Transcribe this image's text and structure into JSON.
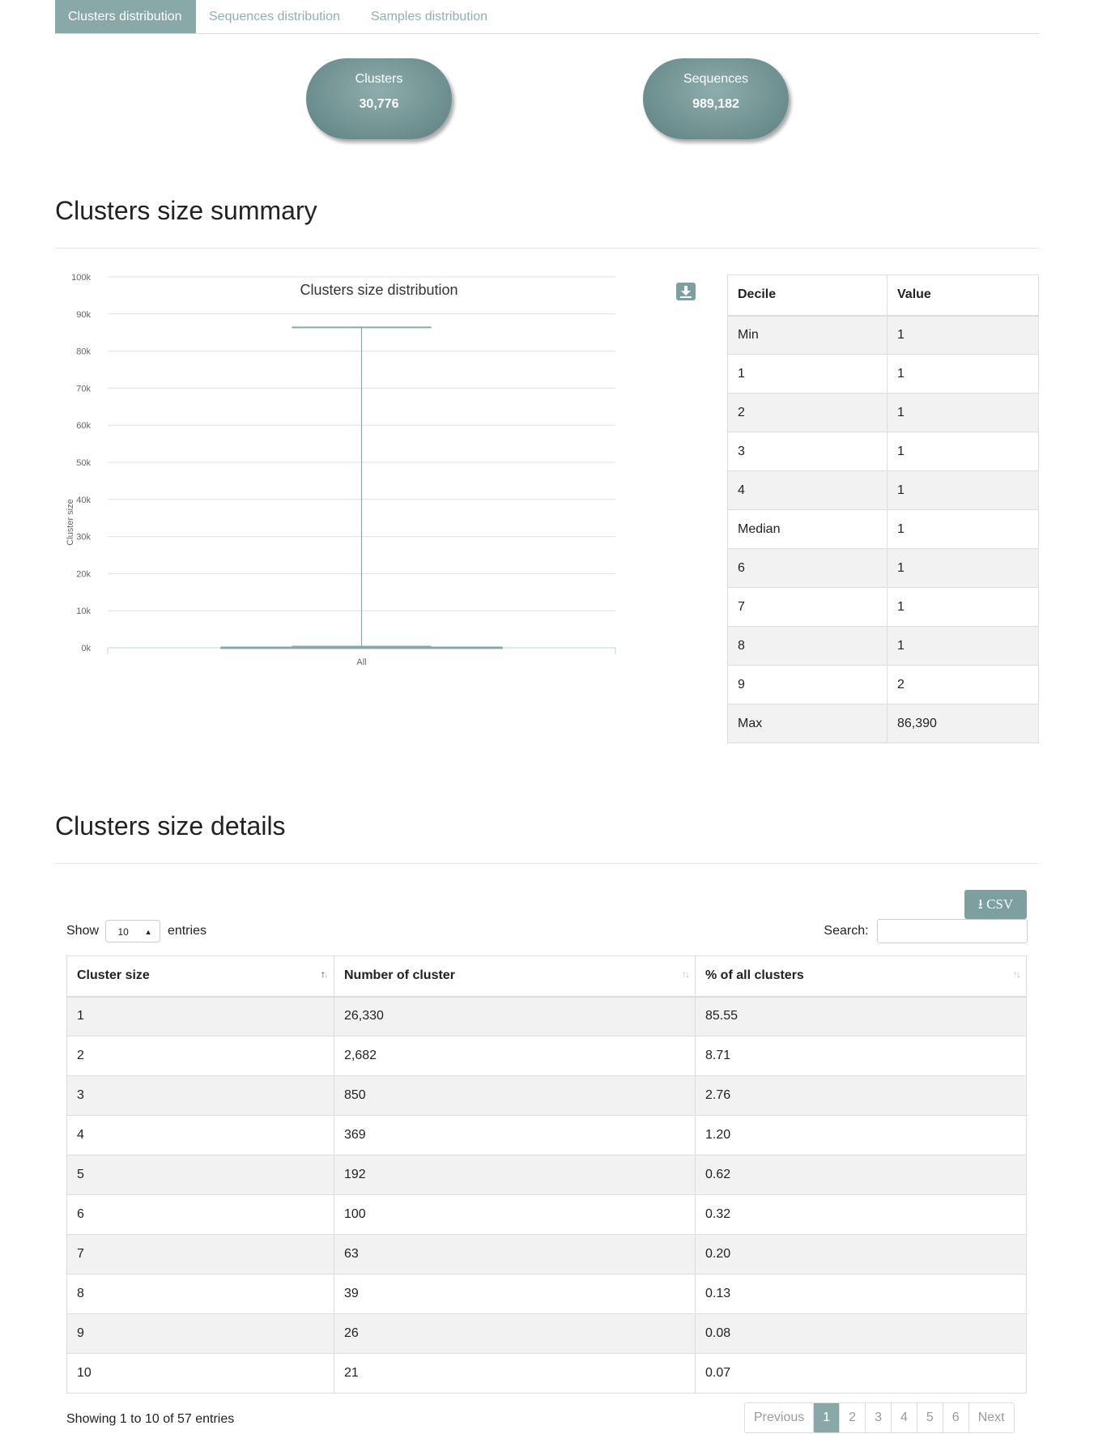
{
  "tabs": [
    {
      "label": "Clusters distribution",
      "active": true
    },
    {
      "label": "Sequences distribution",
      "active": false
    },
    {
      "label": "Samples distribution",
      "active": false
    }
  ],
  "summary": {
    "clusters_label": "Clusters",
    "clusters_value": "30,776",
    "sequences_label": "Sequences",
    "sequences_value": "989,182"
  },
  "size_summary": {
    "heading": "Clusters size summary"
  },
  "chart_data": {
    "type": "boxplot",
    "title": "Clusters size distribution",
    "ylabel": "Cluster size",
    "xlabel": "",
    "categories": [
      "All"
    ],
    "ylim": [
      0,
      100000
    ],
    "yticks": [
      "0k",
      "10k",
      "20k",
      "30k",
      "40k",
      "50k",
      "60k",
      "70k",
      "80k",
      "90k",
      "100k"
    ],
    "ytick_values": [
      0,
      10000,
      20000,
      30000,
      40000,
      50000,
      60000,
      70000,
      80000,
      90000,
      100000
    ],
    "box": {
      "min": 1,
      "q1": 1,
      "median": 1,
      "q3": 1,
      "max": 86390
    },
    "grid": true,
    "color": "#89a8a8"
  },
  "deciles": {
    "headers": [
      "Decile",
      "Value"
    ],
    "rows": [
      [
        "Min",
        "1"
      ],
      [
        "1",
        "1"
      ],
      [
        "2",
        "1"
      ],
      [
        "3",
        "1"
      ],
      [
        "4",
        "1"
      ],
      [
        "Median",
        "1"
      ],
      [
        "6",
        "1"
      ],
      [
        "7",
        "1"
      ],
      [
        "8",
        "1"
      ],
      [
        "9",
        "2"
      ],
      [
        "Max",
        "86,390"
      ]
    ]
  },
  "details": {
    "heading": "Clusters size details",
    "csv_label": "CSV",
    "show_label": "Show",
    "entries_label": "entries",
    "page_length": "10",
    "search_label": "Search:",
    "search_value": "",
    "headers": [
      "Cluster size",
      "Number of cluster",
      "% of all clusters"
    ],
    "rows": [
      [
        "1",
        "26,330",
        "85.55"
      ],
      [
        "2",
        "2,682",
        "8.71"
      ],
      [
        "3",
        "850",
        "2.76"
      ],
      [
        "4",
        "369",
        "1.20"
      ],
      [
        "5",
        "192",
        "0.62"
      ],
      [
        "6",
        "100",
        "0.32"
      ],
      [
        "7",
        "63",
        "0.20"
      ],
      [
        "8",
        "39",
        "0.13"
      ],
      [
        "9",
        "26",
        "0.08"
      ],
      [
        "10",
        "21",
        "0.07"
      ]
    ],
    "info": "Showing 1 to 10 of 57 entries",
    "pager": [
      "Previous",
      "1",
      "2",
      "3",
      "4",
      "5",
      "6",
      "Next"
    ],
    "current_page": "1"
  },
  "colors": {
    "accent": "#89a8a8",
    "pill": "#6d8e8e"
  }
}
